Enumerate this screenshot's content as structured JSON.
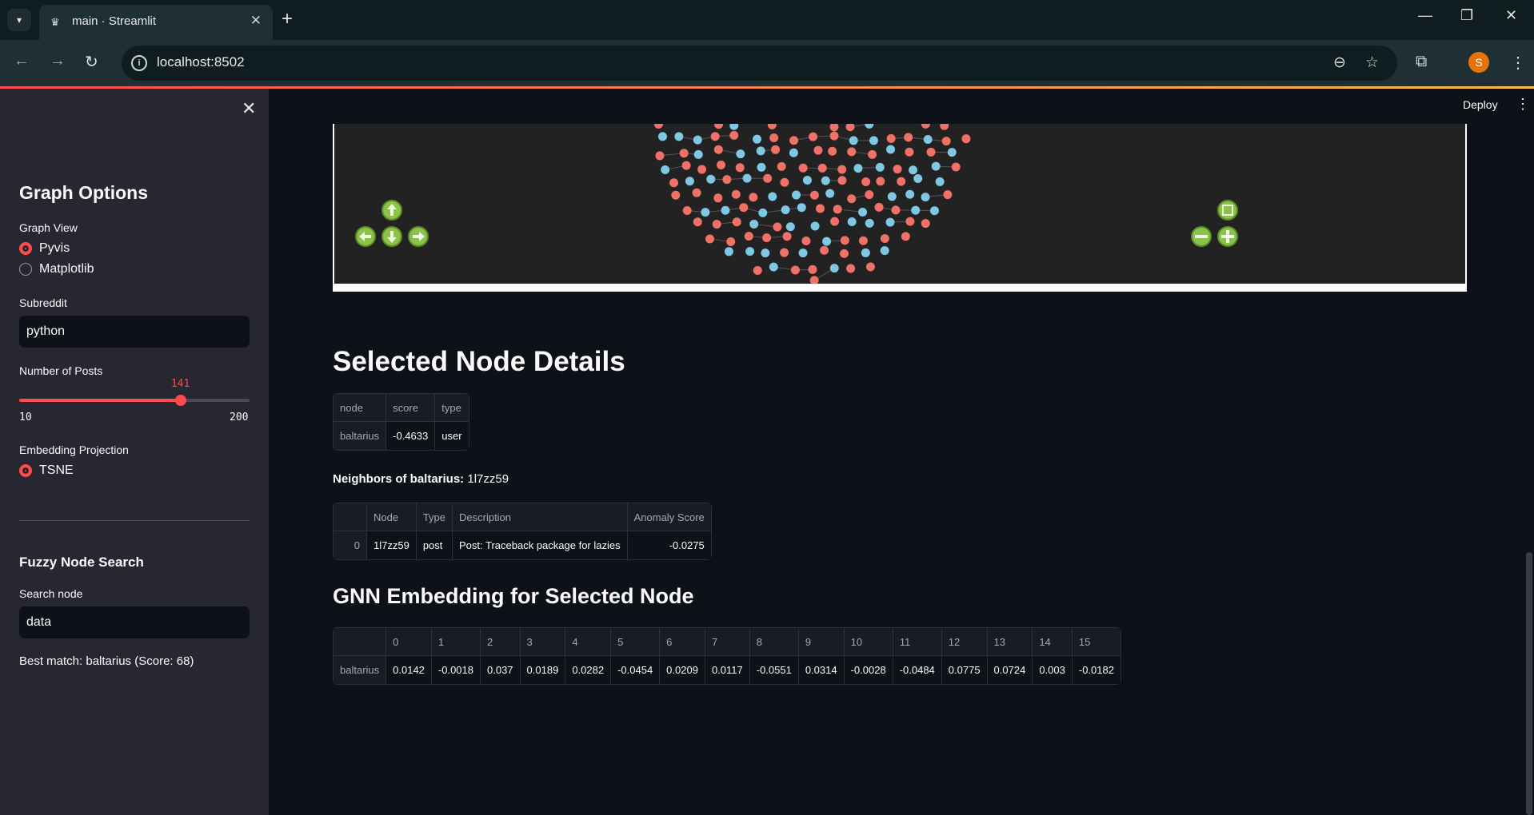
{
  "browser": {
    "tab_title": "main · Streamlit",
    "url": "localhost:8502",
    "profile_initial": "S"
  },
  "app_header": {
    "deploy_label": "Deploy"
  },
  "sidebar": {
    "heading": "Graph Options",
    "graph_view_label": "Graph View",
    "graph_view_options": [
      "Pyvis",
      "Matplotlib"
    ],
    "graph_view_selected": "Pyvis",
    "subreddit_label": "Subreddit",
    "subreddit_value": "python",
    "posts_label": "Number of Posts",
    "posts_value": "141",
    "posts_min": "10",
    "posts_max": "200",
    "posts_fraction": 0.7,
    "projection_label": "Embedding Projection",
    "projection_option": "TSNE",
    "fuzzy_heading": "Fuzzy Node Search",
    "search_label": "Search node",
    "search_value": "data",
    "best_match": "Best match: baltarius (Score: 68)"
  },
  "colors": {
    "accent": "#ff4b4b",
    "user_node": "#7ec8e3",
    "post_node": "#f07167",
    "nav_button": "#8bc34a"
  },
  "selected_node": {
    "heading": "Selected Node Details",
    "columns": [
      "node",
      "score",
      "type"
    ],
    "row": [
      "baltarius",
      "-0.4633",
      "user"
    ]
  },
  "neighbors": {
    "label": "Neighbors of baltarius:",
    "value": "1l7zz59",
    "columns": [
      "",
      "Node",
      "Type",
      "Description",
      "Anomaly Score"
    ],
    "rows": [
      [
        "0",
        "1l7zz59",
        "post",
        "Post: Traceback package for lazies",
        "-0.0275"
      ]
    ]
  },
  "embedding": {
    "heading": "GNN Embedding for Selected Node",
    "columns": [
      "",
      "0",
      "1",
      "2",
      "3",
      "4",
      "5",
      "6",
      "7",
      "8",
      "9",
      "10",
      "11",
      "12",
      "13",
      "14",
      "15"
    ],
    "row": [
      "baltarius",
      "0.0142",
      "-0.0018",
      "0.037",
      "0.0189",
      "0.0282",
      "-0.0454",
      "0.0209",
      "0.0117",
      "-0.0551",
      "0.0314",
      "-0.0028",
      "-0.0484",
      "0.0775",
      "0.0724",
      "0.003",
      "-0.0182"
    ]
  }
}
